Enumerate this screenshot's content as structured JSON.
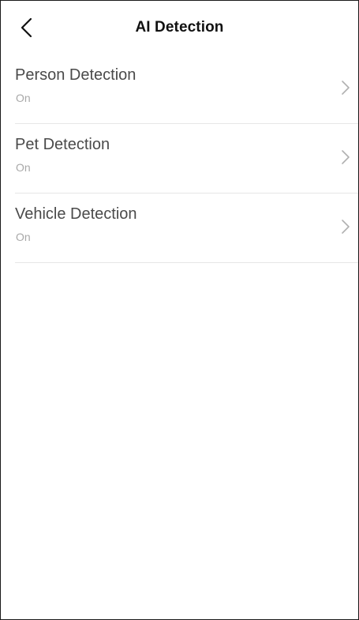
{
  "header": {
    "title": "AI Detection"
  },
  "icons": {
    "back": "chevron-left-icon",
    "row_chevron": "chevron-right-icon"
  },
  "colors": {
    "title": "#111111",
    "label": "#4a4a4a",
    "status": "#a8a8a8",
    "divider": "#e6e6e6",
    "chevron": "#b0b0b0"
  },
  "rows": [
    {
      "label": "Person Detection",
      "status": "On"
    },
    {
      "label": "Pet Detection",
      "status": "On"
    },
    {
      "label": "Vehicle Detection",
      "status": "On"
    }
  ]
}
